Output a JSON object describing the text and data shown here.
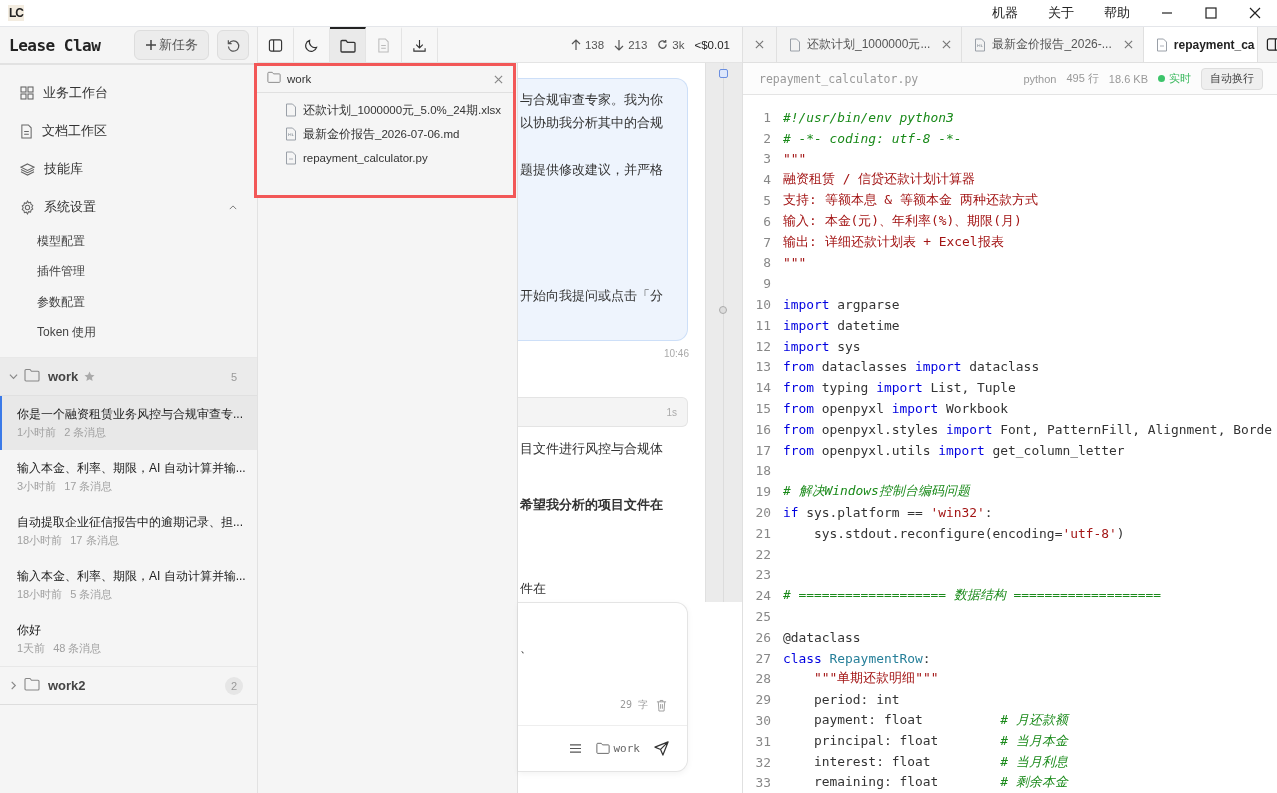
{
  "title_bar": {
    "logo": "LC",
    "menu": [
      "机器",
      "关于",
      "帮助"
    ]
  },
  "sidebar": {
    "app_name": "Lease Claw",
    "new_task_button": "新任务",
    "nav": [
      {
        "label": "业务工作台"
      },
      {
        "label": "文档工作区"
      },
      {
        "label": "技能库"
      },
      {
        "label": "系统设置",
        "expanded": true,
        "children": [
          {
            "label": "模型配置"
          },
          {
            "label": "插件管理"
          },
          {
            "label": "参数配置"
          },
          {
            "label": "Token 使用"
          }
        ]
      }
    ],
    "groups": [
      {
        "name": "work",
        "starred": true,
        "count": "5",
        "expanded": true,
        "sessions": [
          {
            "title": "你是一个融资租赁业务风控与合规审查专...",
            "time": "1小时前",
            "messages": "2 条消息",
            "selected": true
          },
          {
            "title": "输入本金、利率、期限，AI 自动计算并输...",
            "time": "3小时前",
            "messages": "17 条消息",
            "selected": false
          },
          {
            "title": "自动提取企业征信报告中的逾期记录、担...",
            "time": "18小时前",
            "messages": "17 条消息",
            "selected": false
          },
          {
            "title": "输入本金、利率、期限，AI 自动计算并输...",
            "time": "18小时前",
            "messages": "5 条消息",
            "selected": false
          },
          {
            "title": "你好",
            "time": "1天前",
            "messages": "48 条消息",
            "selected": false
          }
        ]
      },
      {
        "name": "work2",
        "starred": false,
        "count": "2",
        "expanded": false
      }
    ]
  },
  "toolbar": {
    "buttons": [
      {
        "selected": false,
        "disabled": false
      },
      {
        "selected": false,
        "disabled": false
      },
      {
        "selected": true,
        "disabled": false
      },
      {
        "selected": false,
        "disabled": true
      },
      {
        "selected": false,
        "disabled": false
      }
    ],
    "stats": [
      {
        "kind": "up",
        "text": "138"
      },
      {
        "kind": "down",
        "text": "213"
      },
      {
        "kind": "cache",
        "text": "3k"
      },
      {
        "kind": "cost",
        "text": "<$0.01"
      }
    ]
  },
  "file_popup": {
    "folder": "work",
    "files": [
      {
        "name": "还款计划_1000000元_5.0%_24期.xlsx"
      },
      {
        "name": "最新金价报告_2026-07-06.md"
      },
      {
        "name": "repayment_calculator.py"
      }
    ]
  },
  "chat": {
    "bubble_paragraphs": [
      [
        "与合规审查专家。我为你",
        "以协助我分析其中的合规"
      ],
      [
        "题提供修改建议，并严格"
      ],
      [
        "开始向我提问或点击「分"
      ]
    ],
    "time": "10:46",
    "step_duration": "1s",
    "reply_lines": [
      {
        "text": "目文件进行风控与合规体",
        "bold": false
      },
      {
        "text": "希望我分析的项目文件在",
        "bold": true
      },
      {
        "text": "件在",
        "bold": false
      }
    ]
  },
  "composer": {
    "text": "、",
    "char_count": "29 字",
    "folder": "work"
  },
  "editor": {
    "tabs": [
      {
        "selected": false
      },
      {
        "label": "还款计划_1000000元...",
        "selected": false
      },
      {
        "label": "最新金价报告_2026-...",
        "selected": false
      },
      {
        "label": "repayment_ca",
        "selected": true
      }
    ],
    "file": "repayment_calculator.py",
    "language": "python",
    "line_count": "495 行",
    "size": "18.6 KB",
    "live": "实时",
    "wrap_button": "自动换行",
    "code": [
      {
        "number": "1",
        "tokens": [
          {
            "kind": "comment",
            "text": "#!/usr/bin/env python3"
          }
        ]
      },
      {
        "number": "2",
        "tokens": [
          {
            "kind": "comment",
            "text": "# -*- coding: utf-8 -*-"
          }
        ]
      },
      {
        "number": "3",
        "tokens": [
          {
            "kind": "string",
            "text": "\"\"\""
          }
        ]
      },
      {
        "number": "4",
        "tokens": [
          {
            "kind": "string",
            "text": "融资租赁 / 信贷还款计划计算器"
          }
        ]
      },
      {
        "number": "5",
        "tokens": [
          {
            "kind": "string",
            "text": "支持: 等额本息 & 等额本金 两种还款方式"
          }
        ]
      },
      {
        "number": "6",
        "tokens": [
          {
            "kind": "string",
            "text": "输入: 本金(元)、年利率(%)、期限(月)"
          }
        ]
      },
      {
        "number": "7",
        "tokens": [
          {
            "kind": "string",
            "text": "输出: 详细还款计划表 + Excel报表"
          }
        ]
      },
      {
        "number": "8",
        "tokens": [
          {
            "kind": "string",
            "text": "\"\"\""
          }
        ]
      },
      {
        "number": "9"
      },
      {
        "number": "10",
        "tokens": [
          {
            "kind": "keyword",
            "text": "import"
          },
          {
            "kind": "plain",
            "text": " argparse"
          }
        ]
      },
      {
        "number": "11",
        "tokens": [
          {
            "kind": "keyword",
            "text": "import"
          },
          {
            "kind": "plain",
            "text": " datetime"
          }
        ]
      },
      {
        "number": "12",
        "tokens": [
          {
            "kind": "keyword",
            "text": "import"
          },
          {
            "kind": "plain",
            "text": " sys"
          }
        ]
      },
      {
        "number": "13",
        "tokens": [
          {
            "kind": "keyword",
            "text": "from"
          },
          {
            "kind": "plain",
            "text": " dataclasses "
          },
          {
            "kind": "keyword",
            "text": "import"
          },
          {
            "kind": "plain",
            "text": " dataclass"
          }
        ]
      },
      {
        "number": "14",
        "tokens": [
          {
            "kind": "keyword",
            "text": "from"
          },
          {
            "kind": "plain",
            "text": " typing "
          },
          {
            "kind": "keyword",
            "text": "import"
          },
          {
            "kind": "plain",
            "text": " List, Tuple"
          }
        ]
      },
      {
        "number": "15",
        "tokens": [
          {
            "kind": "keyword",
            "text": "from"
          },
          {
            "kind": "plain",
            "text": " openpyxl "
          },
          {
            "kind": "keyword",
            "text": "import"
          },
          {
            "kind": "plain",
            "text": " Workbook"
          }
        ]
      },
      {
        "number": "16",
        "tokens": [
          {
            "kind": "keyword",
            "text": "from"
          },
          {
            "kind": "plain",
            "text": " openpyxl.styles "
          },
          {
            "kind": "keyword",
            "text": "import"
          },
          {
            "kind": "plain",
            "text": " Font, PatternFill, Alignment, Borde"
          }
        ]
      },
      {
        "number": "17",
        "tokens": [
          {
            "kind": "keyword",
            "text": "from"
          },
          {
            "kind": "plain",
            "text": " openpyxl.utils "
          },
          {
            "kind": "keyword",
            "text": "import"
          },
          {
            "kind": "plain",
            "text": " get_column_letter"
          }
        ]
      },
      {
        "number": "18"
      },
      {
        "number": "19",
        "tokens": [
          {
            "kind": "comment",
            "text": "# 解决Windows控制台编码问题"
          }
        ]
      },
      {
        "number": "20",
        "tokens": [
          {
            "kind": "keyword",
            "text": "if"
          },
          {
            "kind": "plain",
            "text": " sys.platform == "
          },
          {
            "kind": "string",
            "text": "'win32'"
          },
          {
            "kind": "plain",
            "text": ":"
          }
        ]
      },
      {
        "number": "21",
        "tokens": [
          {
            "kind": "plain",
            "text": "    sys.stdout.reconfigure(encoding="
          },
          {
            "kind": "string",
            "text": "'utf-8'"
          },
          {
            "kind": "plain",
            "text": ")"
          }
        ]
      },
      {
        "number": "22"
      },
      {
        "number": "23"
      },
      {
        "number": "24",
        "tokens": [
          {
            "kind": "comment",
            "text": "# =================== 数据结构 ==================="
          }
        ]
      },
      {
        "number": "25"
      },
      {
        "number": "26",
        "tokens": [
          {
            "kind": "plain",
            "text": "@dataclass"
          }
        ]
      },
      {
        "number": "27",
        "tokens": [
          {
            "kind": "keyword",
            "text": "class"
          },
          {
            "kind": "class",
            "text": " RepaymentRow"
          },
          {
            "kind": "plain",
            "text": ":"
          }
        ]
      },
      {
        "number": "28",
        "tokens": [
          {
            "kind": "string",
            "text": "    \"\"\"单期还款明细\"\"\""
          }
        ]
      },
      {
        "number": "29",
        "tokens": [
          {
            "kind": "plain",
            "text": "    period: int"
          }
        ]
      },
      {
        "number": "30",
        "tokens": [
          {
            "kind": "plain",
            "text": "    payment: float          "
          },
          {
            "kind": "comment",
            "text": "# 月还款额"
          }
        ]
      },
      {
        "number": "31",
        "tokens": [
          {
            "kind": "plain",
            "text": "    principal: float        "
          },
          {
            "kind": "comment",
            "text": "# 当月本金"
          }
        ]
      },
      {
        "number": "32",
        "tokens": [
          {
            "kind": "plain",
            "text": "    interest: float         "
          },
          {
            "kind": "comment",
            "text": "# 当月利息"
          }
        ]
      },
      {
        "number": "33",
        "tokens": [
          {
            "kind": "plain",
            "text": "    remaining: float        "
          },
          {
            "kind": "comment",
            "text": "# 剩余本金"
          }
        ]
      }
    ]
  }
}
